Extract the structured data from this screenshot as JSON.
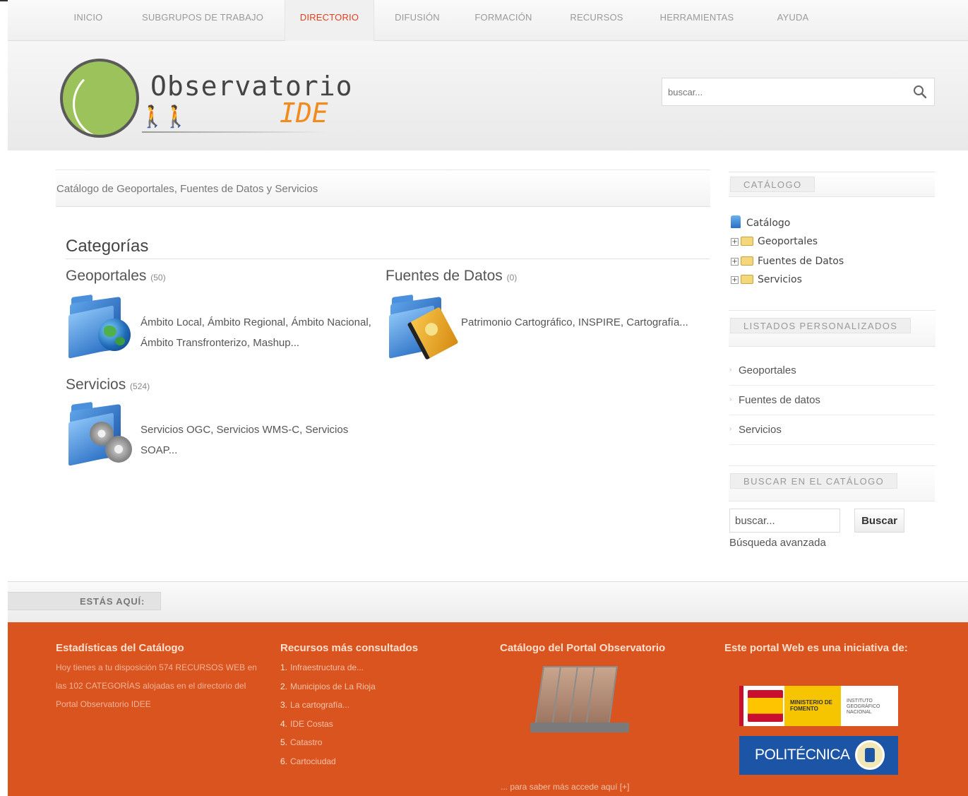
{
  "nav": {
    "items": [
      {
        "label": "INICIO"
      },
      {
        "label": "SUBGRUPOS DE TRABAJO"
      },
      {
        "label": "DIRECTORIO",
        "active": true
      },
      {
        "label": "DIFUSIÓN"
      },
      {
        "label": "FORMACIÓN"
      },
      {
        "label": "RECURSOS"
      },
      {
        "label": "HERRAMIENTAS"
      },
      {
        "label": "AYUDA"
      }
    ],
    "active_color": "#e2401d"
  },
  "header": {
    "logo_title": "Observatorio",
    "logo_subtitle": "IDE",
    "search_placeholder": "buscar..."
  },
  "breadcrumb": "Catálogo de Geoportales, Fuentes de Datos y Servicios",
  "categories": {
    "heading": "Categorías",
    "items": [
      {
        "title": "Geoportales",
        "count": "(50)",
        "description": "Ámbito Local, Ámbito Regional, Ámbito Nacional, Ámbito Transfronterizo, Mashup..."
      },
      {
        "title": "Fuentes de Datos",
        "count": "(0)",
        "description": "Patrimonio Cartográfico, INSPIRE, Cartografía..."
      },
      {
        "title": "Servicios",
        "count": "(524)",
        "description": "Servicios OGC, Servicios WMS-C, Servicios SOAP..."
      }
    ]
  },
  "sidebar": {
    "catalog_title": "CATÁLOGO",
    "tree_root": "Catálogo",
    "tree_items": [
      "Geoportales",
      "Fuentes de Datos",
      "Servicios"
    ],
    "lists_title": "LISTADOS PERSONALIZADOS",
    "lists": [
      "Geoportales",
      "Fuentes de datos",
      "Servicios"
    ],
    "search_title": "BUSCAR EN EL CATÁLOGO",
    "search_value": "buscar...",
    "search_button": "Buscar",
    "advanced_search": "Búsqueda avanzada"
  },
  "here_label": "ESTÁS AQUÍ:",
  "footer": {
    "col1_title": "Estadísticas del Catálogo",
    "col1_text": "Hoy tienes a tu disposición 574 RECURSOS WEB en las 102 CATEGORÍAS alojadas en el directorio del Portal Observatorio IDEE",
    "col2_title": "Recursos más consultados",
    "col2_items": [
      {
        "num": "1.",
        "text": "Infraestructura de..."
      },
      {
        "num": "2.",
        "text": "Municipios de La Rioja"
      },
      {
        "num": "3.",
        "text": "La cartografía..."
      },
      {
        "num": "4.",
        "text": "IDE Costas"
      },
      {
        "num": "5.",
        "text": "Catastro"
      },
      {
        "num": "6.",
        "text": "Cartociudad"
      }
    ],
    "col3_title": "Catálogo del Portal Observatorio",
    "col3_link": "... para saber más accede aquí [+]",
    "col4_title": "Este portal Web es una iniciativa de:",
    "logo_ministerio": "MINISTERIO DE FOMENTO",
    "logo_ign": "INSTITUTO GEOGRÁFICO NACIONAL",
    "logo_upm": "POLITÉCNICA",
    "bg_color": "#d9541e"
  }
}
